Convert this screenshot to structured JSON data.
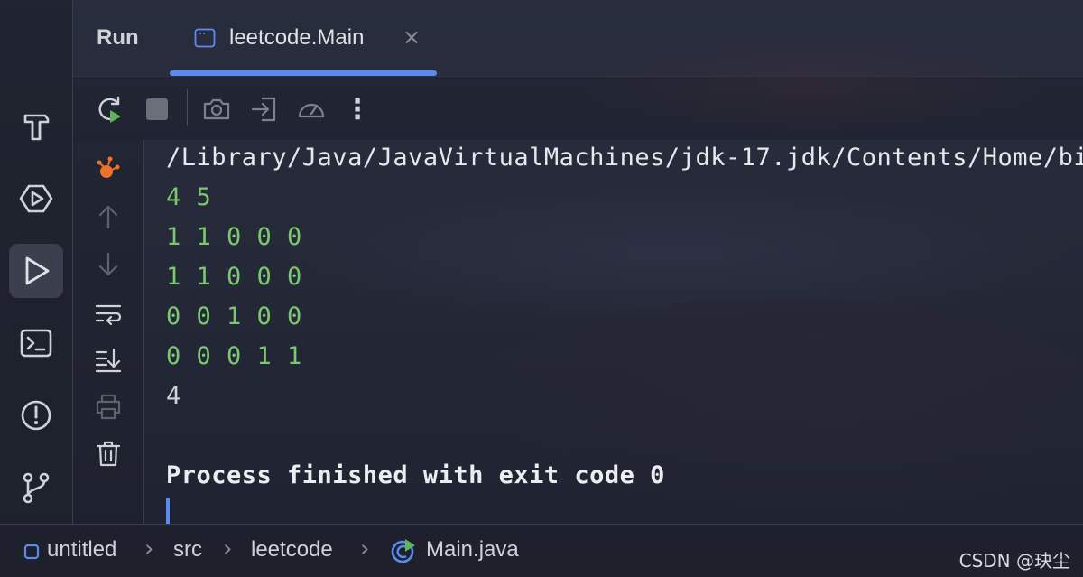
{
  "header": {
    "run_title": "Run",
    "tab_label": "leetcode.Main",
    "tab_close": "×"
  },
  "tool_strip": {
    "items": [
      {
        "icon": "hammer-icon"
      },
      {
        "icon": "services-icon"
      },
      {
        "icon": "run-icon",
        "active": true
      },
      {
        "icon": "terminal-icon"
      },
      {
        "icon": "problems-icon"
      },
      {
        "icon": "git-icon"
      }
    ]
  },
  "toolbar": {
    "items": [
      "rerun-icon",
      "stop-icon",
      "camera-icon",
      "login-icon",
      "gauge-icon",
      "more-icon"
    ],
    "more_label": "⋮"
  },
  "gutter": {
    "items": [
      "debug-source-icon",
      "arrow-up-icon",
      "arrow-down-icon",
      "soft-wrap-icon",
      "scroll-to-end-icon",
      "print-icon",
      "trash-icon"
    ]
  },
  "console": {
    "lines": [
      "/Library/Java/JavaVirtualMachines/jdk-17.jdk/Contents/Home/bi",
      "4 5",
      "1 1 0 0 0",
      "1 1 0 0 0",
      "0 0 1 0 0",
      "0 0 0 1 1",
      "4",
      "",
      "Process finished with exit code 0"
    ]
  },
  "statusbar": {
    "crumbs": [
      "untitled",
      "src",
      "leetcode",
      "Main.java"
    ],
    "separator": "›",
    "watermark": "CSDN @玦尘"
  },
  "colors": {
    "accent": "#5a8cf0",
    "output_green": "#7bc96f",
    "debug_orange": "#f0712a"
  }
}
